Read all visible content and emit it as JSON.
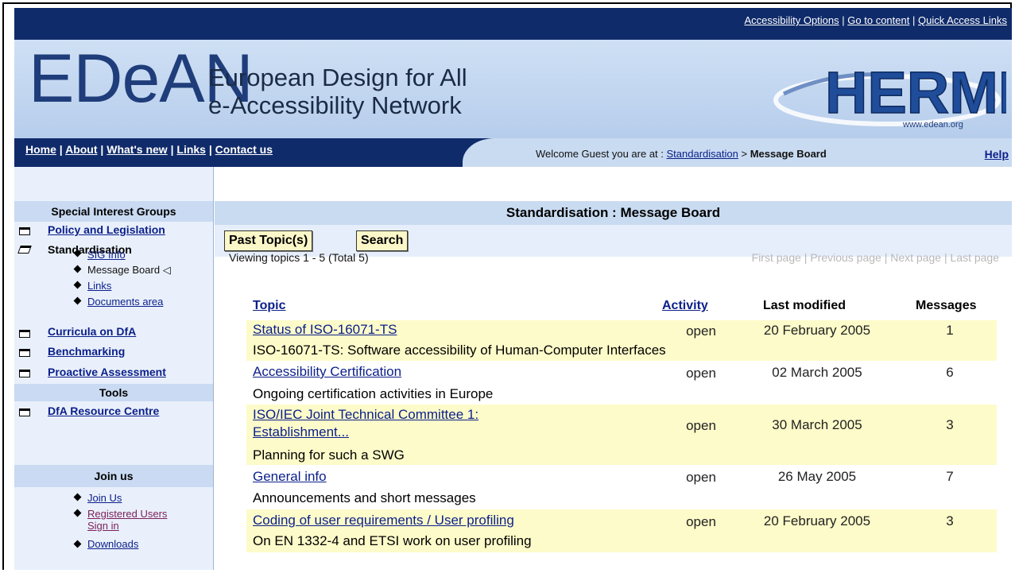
{
  "top_links": {
    "accessibility": "Accessibility Options",
    "sep1": "|",
    "goto": "Go to content",
    "sep2": "|",
    "quick": "Quick Access Links"
  },
  "banner": {
    "logo": "EDeAN",
    "sub1": "European Design for All",
    "sub2": "e-Accessibility Network",
    "hermes": "HERMES",
    "hermes_url": "www.edean.org"
  },
  "nav": {
    "home": "Home",
    "about": "About",
    "whatsnew": "What's new",
    "links": "Links",
    "contact": "Contact us",
    "sep": "|"
  },
  "welcome": {
    "prefix": "Welcome Guest you are at :",
    "crumb1": "Standardisation",
    "arrow": ">",
    "crumb2": "Message Board",
    "help": "Help"
  },
  "sidebar": {
    "sig_title": "Special Interest Groups",
    "policy": "Policy and Legislation",
    "standardisation": "Standardisation",
    "sub_sig": "SIG Info",
    "sub_board": "Message Board",
    "sub_board_marker": "◁",
    "sub_links": "Links",
    "sub_docs": "Documents area",
    "curricula": "Curricula on DfA",
    "bench": "Benchmarking",
    "proactive": "Proactive Assessment",
    "tools": "Tools",
    "resource": "DfA Resource Centre",
    "join_title": "Join us",
    "join": "Join Us",
    "registered": "Registered Users",
    "signin": "Sign in",
    "downloads": "Downloads"
  },
  "main": {
    "title": "Standardisation : Message Board",
    "btn_past": "Past Topic(s)",
    "btn_search": "Search",
    "viewing": "Viewing topics 1 - 5 (Total 5)",
    "pager": {
      "first": "First page",
      "prev": "Previous page",
      "next": "Next page",
      "last": "Last page",
      "sep": "|"
    },
    "headers": {
      "topic": "Topic",
      "activity": "Activity",
      "modified": "Last modified",
      "messages": "Messages"
    },
    "rows": [
      {
        "topic": "Status of ISO-16071-TS",
        "desc": "ISO-16071-TS: Software accessibility of Human-Computer Interfaces",
        "activity": "open",
        "date": "20 February 2005",
        "messages": "1"
      },
      {
        "topic": "Accessibility Certification",
        "desc": "Ongoing certification activities in Europe",
        "activity": "open",
        "date": "02 March 2005",
        "messages": "6"
      },
      {
        "topic": "ISO/IEC Joint Technical Committee 1:",
        "topic2": "Establishment...",
        "desc": "Planning for such a SWG",
        "activity": "open",
        "date": "30 March 2005",
        "messages": "3"
      },
      {
        "topic": "General info",
        "desc": "Announcements and short messages",
        "activity": "open",
        "date": "26 May 2005",
        "messages": "7"
      },
      {
        "topic": "Coding of user requirements / User profiling",
        "desc": "On EN 1332-4 and ETSI work on user profiling",
        "activity": "open",
        "date": "20 February 2005",
        "messages": "3"
      }
    ]
  }
}
